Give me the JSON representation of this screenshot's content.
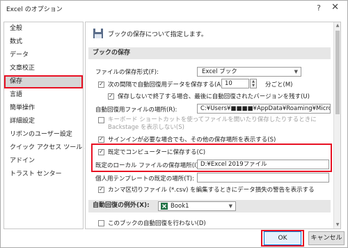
{
  "window": {
    "title": "Excel のオプション",
    "help_label": "?",
    "close_label": "✕"
  },
  "sidebar": {
    "items": [
      {
        "label": "全般"
      },
      {
        "label": "数式"
      },
      {
        "label": "データ"
      },
      {
        "label": "文章校正"
      },
      {
        "label": "保存"
      },
      {
        "label": "言語"
      },
      {
        "label": "簡単操作"
      },
      {
        "label": "詳細設定"
      },
      {
        "label": "リボンのユーザー設定"
      },
      {
        "label": "クイック アクセス ツール バー"
      },
      {
        "label": "アドイン"
      },
      {
        "label": "トラスト センター"
      }
    ],
    "selected": "保存"
  },
  "content": {
    "header": "ブックの保存について指定します。",
    "save_section": {
      "title": "ブックの保存",
      "file_format_label": "ファイルの保存形式(F):",
      "file_format_value": "Excel ブック",
      "autorecover_label": "次の間隔で自動回復用データを保存する(A):",
      "autorecover_minutes": "10",
      "minutes_unit": "分ごと(M)",
      "keep_last_label": "保存しないで終了する場合、最後に自動回復されたバージョンを残す(U)",
      "autorecover_location_label": "自動回復用ファイルの場所(R):",
      "autorecover_location_value": "C:¥Users¥■■■■¥AppData¥Roaming¥Microso",
      "keyboard_shortcut_label": "キーボード ショートカットを使ってファイルを開いたり保存したりするときに Backstage を表示しない(S)",
      "show_additional_label": "サインインが必要な場合でも、その他の保存場所を表示する(S)",
      "save_to_computer_label": "既定でコンピューターに保存する(C)",
      "default_local_label": "既定のローカル ファイルの保存場所(I):",
      "default_local_value": "D:¥Excel 2019ファイル",
      "personal_templates_label": "個人用テンプレートの既定の場所(T):",
      "csv_warning_label": "カンマ区切りファイル (*.csv) を編集するときにデータ損失の警告を表示する"
    },
    "autorecover_exceptions": {
      "title": "自動回復の例外(X):",
      "book_value": "Book1",
      "disable_label": "このブックの自動回復を行わない(D)"
    }
  },
  "buttons": {
    "ok_label": "OK",
    "cancel_label": "キャンセル"
  }
}
